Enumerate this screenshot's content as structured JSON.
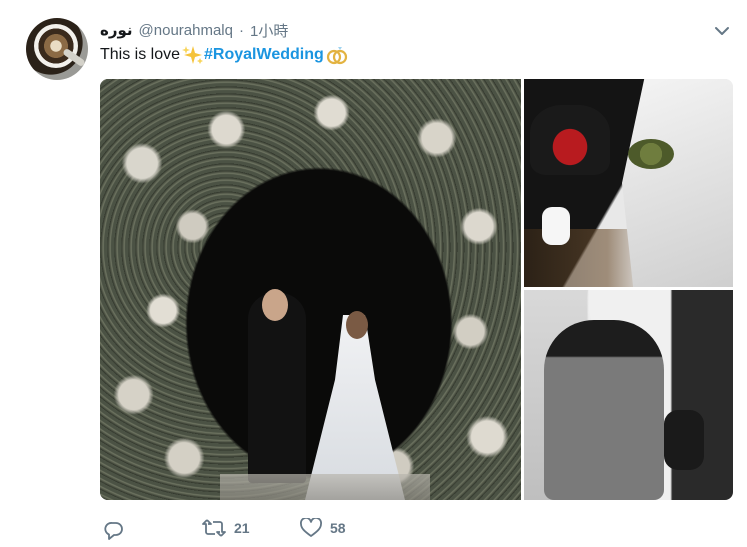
{
  "tweet": {
    "display_name": "نوره",
    "handle": "@nourahmalq",
    "separator": "·",
    "time": "1小時",
    "text_prefix": "This is love",
    "hashtag": "#RoyalWedding",
    "icons": {
      "chevron": "chevron-down-icon",
      "sparkles": "sparkles-emoji",
      "rings": "rings-emoji",
      "reply": "reply-icon",
      "retweet": "retweet-icon",
      "like": "heart-icon"
    },
    "colors": {
      "hashtag": "#1b95e0",
      "meta": "#657786",
      "text": "#14171a"
    }
  },
  "media": {
    "photo_count": 3
  },
  "actions": {
    "reply_count": "",
    "retweet_count": "21",
    "like_count": "58"
  }
}
